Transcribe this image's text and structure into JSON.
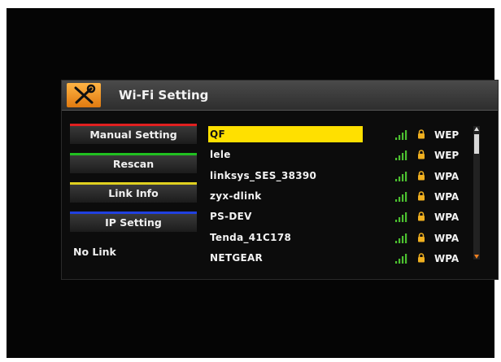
{
  "window": {
    "title": "Wi-Fi Setting",
    "icon": "tools-icon"
  },
  "sidebar": {
    "buttons": [
      {
        "label": "Manual Setting",
        "color": "#e02020"
      },
      {
        "label": "Rescan",
        "color": "#20c020"
      },
      {
        "label": "Link Info",
        "color": "#e0d020"
      },
      {
        "label": "IP Setting",
        "color": "#2040e0"
      }
    ],
    "status": "No Link"
  },
  "networks": [
    {
      "ssid": "QF",
      "security": "WEP",
      "selected": true,
      "signal_icon": "signal-icon",
      "lock_icon": "lock-icon"
    },
    {
      "ssid": "lele",
      "security": "WEP",
      "selected": false,
      "signal_icon": "signal-icon",
      "lock_icon": "lock-icon"
    },
    {
      "ssid": "linksys_SES_38390",
      "security": "WPA",
      "selected": false,
      "signal_icon": "signal-icon",
      "lock_icon": "lock-icon"
    },
    {
      "ssid": "zyx-dlink",
      "security": "WPA",
      "selected": false,
      "signal_icon": "signal-icon",
      "lock_icon": "lock-icon"
    },
    {
      "ssid": "PS-DEV",
      "security": "WPA",
      "selected": false,
      "signal_icon": "signal-icon",
      "lock_icon": "lock-icon"
    },
    {
      "ssid": "Tenda_41C178",
      "security": "WPA",
      "selected": false,
      "signal_icon": "signal-icon",
      "lock_icon": "lock-icon"
    },
    {
      "ssid": "NETGEAR",
      "security": "WPA",
      "selected": false,
      "signal_icon": "signal-icon",
      "lock_icon": "lock-icon"
    }
  ],
  "colors": {
    "selection": "#ffe000",
    "signal": "#4cc030",
    "lock": "#f0b020",
    "title_icon_bg": "#f39a20"
  }
}
